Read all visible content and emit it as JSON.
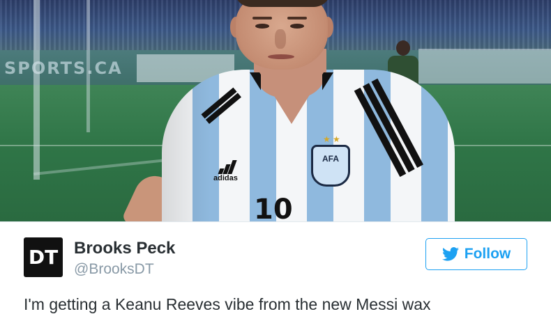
{
  "photo": {
    "ad_board_text": "SPORTS.CA",
    "jersey_number": "10",
    "shirt_brand": "adidas",
    "crest_text": "AFA"
  },
  "tweet": {
    "avatar_text": "DT",
    "display_name": "Brooks Peck",
    "handle": "@BrooksDT",
    "follow_label": "Follow",
    "text": "I'm getting a Keanu Reeves vibe from the new Messi wax"
  },
  "icons": {
    "follow": "twitter-bird-icon"
  },
  "colors": {
    "twitter_blue": "#1da1f2",
    "avatar_bg": "#111111",
    "name_text": "#292f33",
    "handle_text": "#8899a6"
  }
}
